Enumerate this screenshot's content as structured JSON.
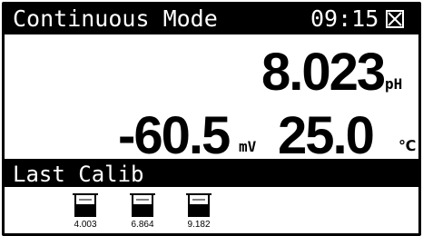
{
  "header": {
    "title": "Continuous Mode",
    "time": "09:15"
  },
  "readings": {
    "ph_value": "8.023",
    "ph_unit": "pH",
    "mv_value": "-60.5",
    "mv_unit": "mV",
    "temp_value": "25.0",
    "temp_unit": "℃"
  },
  "calibration": {
    "label": "Last Calib",
    "buffers": [
      "4.003",
      "6.864",
      "9.182"
    ]
  },
  "icons": {
    "close": "close-icon",
    "beaker": "beaker-icon"
  },
  "colors": {
    "foreground": "#000000",
    "background": "#ffffff"
  }
}
